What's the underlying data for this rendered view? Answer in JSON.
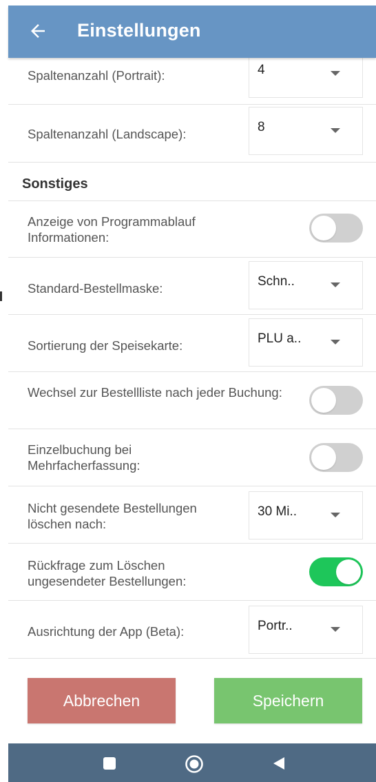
{
  "appbar": {
    "title": "Einstellungen",
    "back_icon": "arrow-left-icon"
  },
  "settings_top": [
    {
      "label": "Spaltenanzahl (Portrait):",
      "value": "4"
    },
    {
      "label": "Spaltenanzahl (Landscape):",
      "value": "8"
    }
  ],
  "section": {
    "title": "Sonstiges"
  },
  "settings": [
    {
      "type": "toggle",
      "label": "Anzeige von Programmablauf Informationen:",
      "on": false
    },
    {
      "type": "dropdown",
      "label": "Standard-Bestellmaske:",
      "value": "Schn.."
    },
    {
      "type": "dropdown",
      "label": "Sortierung der Speisekarte:",
      "value": "PLU a.."
    },
    {
      "type": "toggle",
      "label": "Wechsel zur Bestellliste nach jeder Buchung:",
      "on": false
    },
    {
      "type": "toggle",
      "label": "Einzelbuchung bei Mehrfacherfassung:",
      "on": false
    },
    {
      "type": "dropdown",
      "label": "Nicht gesendete Bestellungen löschen nach:",
      "value": "30 Mi.."
    },
    {
      "type": "toggle",
      "label": "Rückfrage zum Löschen ungesendeter Bestellungen:",
      "on": true
    },
    {
      "type": "dropdown",
      "label": "Ausrichtung der App (Beta):",
      "value": "Portr.."
    }
  ],
  "buttons": {
    "cancel": "Abbrechen",
    "save": "Speichern"
  },
  "navbar": {
    "icons": [
      "recents-square-icon",
      "home-circle-icon",
      "back-triangle-icon"
    ]
  },
  "colors": {
    "appbar": "#6795c4",
    "toggle_on": "#1ec65a",
    "toggle_off": "#d0d0d0",
    "cancel": "#c97670",
    "save": "#78c56f",
    "navbar": "#4f6a84"
  }
}
